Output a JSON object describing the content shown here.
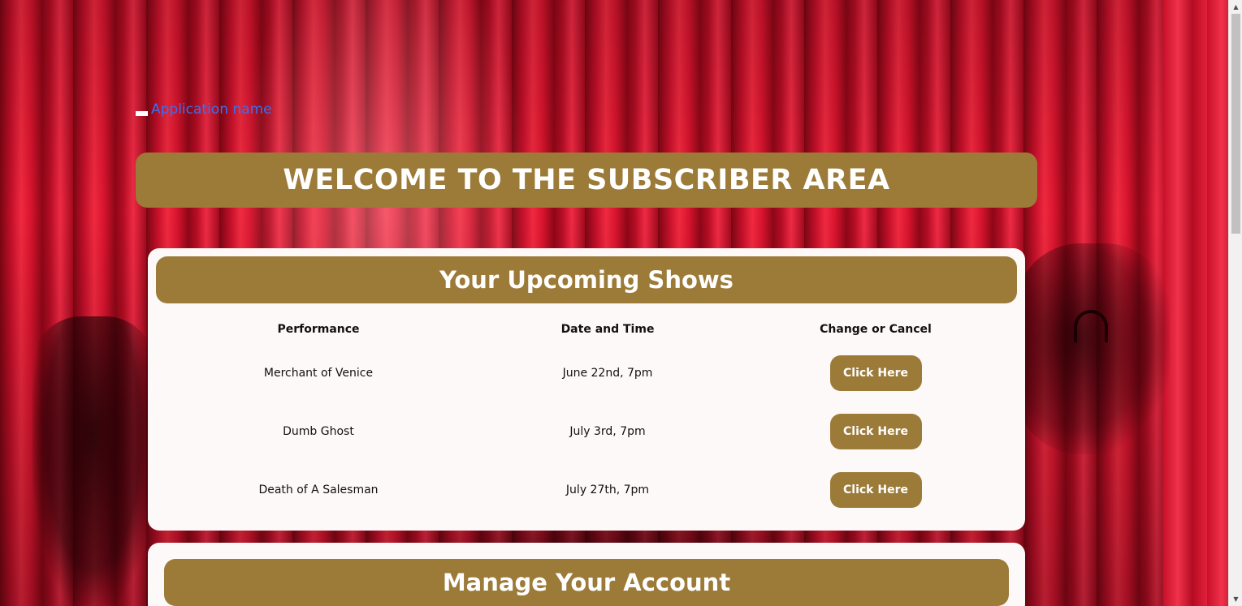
{
  "brand": {
    "icon": "logo-icon",
    "name": "Application name"
  },
  "welcome": {
    "title": "WELCOME TO THE SUBSCRIBER AREA"
  },
  "shows": {
    "title": "Your Upcoming Shows",
    "columns": [
      "Performance",
      "Date and Time",
      "Change or Cancel"
    ],
    "rows": [
      {
        "performance": "Merchant of Venice",
        "datetime": "June 22nd, 7pm",
        "action": "Click Here"
      },
      {
        "performance": "Dumb Ghost",
        "datetime": "July 3rd, 7pm",
        "action": "Click Here"
      },
      {
        "performance": "Death of A Salesman",
        "datetime": "July 27th, 7pm",
        "action": "Click Here"
      }
    ]
  },
  "account": {
    "title": "Manage Your Account"
  },
  "colors": {
    "accent": "#9c7a38",
    "card_background": "#fdf9f8",
    "link": "#3a6ff0",
    "curtain": "#d8142e"
  },
  "scrollbar": {
    "up_icon": "scroll-up-arrow-icon",
    "down_icon": "scroll-down-arrow-icon"
  }
}
